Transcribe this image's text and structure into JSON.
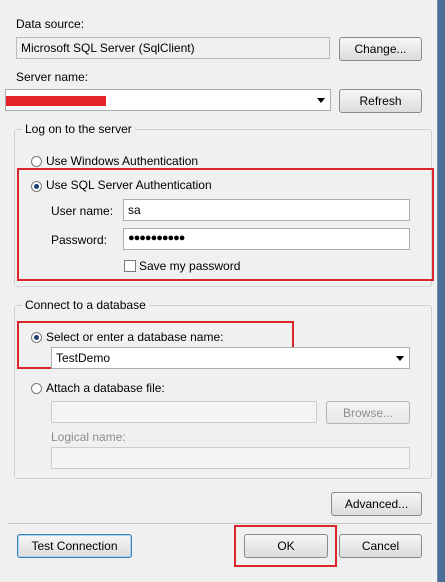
{
  "data_source": {
    "label": "Data source:",
    "value": "Microsoft SQL Server (SqlClient)",
    "change_label": "Change..."
  },
  "server": {
    "label": "Server name:",
    "value": "",
    "refresh_label": "Refresh"
  },
  "logon": {
    "title": "Log on to the server",
    "windows_auth_label": "Use Windows Authentication",
    "sql_auth_label": "Use SQL Server Authentication",
    "selected": "sql",
    "username_label": "User name:",
    "username_value": "sa",
    "password_label": "Password:",
    "password_value": "●●●●●●●●●●",
    "save_password_label": "Save my password",
    "save_password_checked": false
  },
  "database": {
    "title": "Connect to a database",
    "select_label": "Select or enter a database name:",
    "select_value": "TestDemo",
    "attach_label": "Attach a database file:",
    "attach_value": "",
    "browse_label": "Browse...",
    "logical_name_label": "Logical name:",
    "logical_name_value": ""
  },
  "buttons": {
    "advanced_label": "Advanced...",
    "test_connection_label": "Test Connection",
    "ok_label": "OK",
    "cancel_label": "Cancel"
  },
  "colors": {
    "highlight": "#d8262c",
    "window_bg": "#f0f0f0"
  }
}
